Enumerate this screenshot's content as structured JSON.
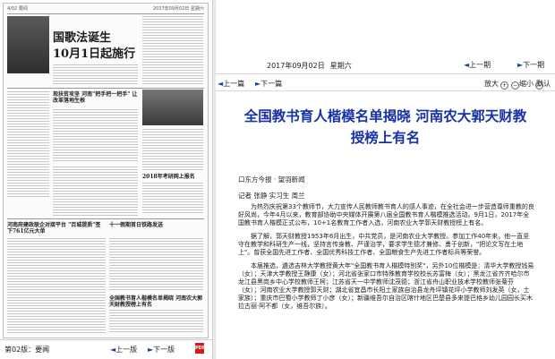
{
  "left_page": {
    "top_left": "4/02 要闻",
    "top_right": "2017年09月02日 星期六",
    "headline_1": "国歌法诞生",
    "headline_2": "10月1日起施行",
    "story_1": "现扶贫攻坚 河南\"把手把一把手\" 让改革落地生根",
    "story_2": "河南府建政联企对接平台 \"百城提质\"签下761亿元大单",
    "story_3": "全国教书育人楷模名单揭晓 河南农大郭天财教授榜上有名",
    "story_4": "2018年考研网上报名",
    "story_5": "十一假期首日铁路发送"
  },
  "left_footer": {
    "edition": "第02版：要闻",
    "prev": "上一版",
    "next": "下一版"
  },
  "header": {
    "date": "2017年09月02日",
    "weekday": "星期六",
    "prev_issue": "上一期",
    "next_issue": "下一期"
  },
  "article_nav": {
    "prev": "上一篇",
    "next": "下一篇",
    "zoom_in": "放大",
    "zoom_out": "缩小",
    "reset": "默认"
  },
  "article": {
    "title_line1": "全国教书育人楷模名单揭晓 河南农大郭天财教",
    "title_line2": "授榜上有名",
    "source": "口东方今报 · 望羽新闻",
    "authors": "记者 张静 实习生 周兰",
    "paragraphs": [
      "为热烈庆祝第33个教师节，大力宣传人民教师教书育人的感人事迹，在全社会进一步营造尊师重教的良好风尚，今年4月以来，教育部协助中央媒体开展第八届全国教书育人楷模推选活动。9月1日，2017年全国教书育人楷模正式公布，10+1名教育工作者入选，河南农业大学郭天财教授榜上有名。",
      "据了解，郭天财教授1953年6月出生，中共党员，是河南农业大学教授。参加工作40年来，他一直坚守在教学和科研生产一线，坚持言传身教、严谨治学，要求学生德才兼修、勇于创新，\"把论文写在土地上\"。曾获全国先进工作者、全国优秀科技工作者、全国粮食生产先进工作者标兵等荣誉。",
      "本届推选，遴选吉林大学教授黄大年\"全国教书育人楷模特别奖\"，另外10位楷模是：清华大学教授钱易（女）；天津大学教授王静康（女）；河北省张家口市特殊教育学校校长苏富梅（女）；黑龙江省齐齐哈尔市龙江县黑岗乡中心学校教师王柯；江苏省天一中学教师沈茂德；浙江省舟山职业技术学校教师张菊芬（女）；河南农业大学教授郭天财；湖北省宜昌市长阳土家族自治县龙舟坪镇花坪小学教师刘发英（女，土家族）；重庆市巴蜀小学教师丁小彦（女）；新疆维吾尔自治区喀什地区巴楚县多来提巴格乡幼儿园园长买木拉古丽·阿不都（女，维吾尔族）。"
    ]
  }
}
